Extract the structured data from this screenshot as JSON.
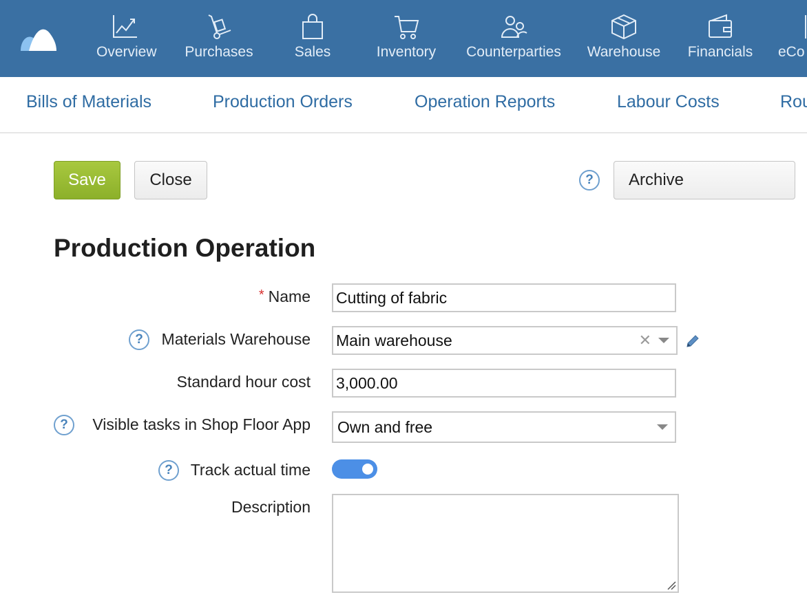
{
  "topnav": {
    "items": [
      {
        "label": "Overview",
        "icon": "chart-line-icon"
      },
      {
        "label": "Purchases",
        "icon": "hand-truck-icon"
      },
      {
        "label": "Sales",
        "icon": "shopping-bag-icon"
      },
      {
        "label": "Inventory",
        "icon": "shopping-cart-icon"
      },
      {
        "label": "Counterparties",
        "icon": "people-icon"
      },
      {
        "label": "Warehouse",
        "icon": "box-icon"
      },
      {
        "label": "Financials",
        "icon": "wallet-icon"
      },
      {
        "label": "eCo",
        "icon": "ecommerce-icon"
      }
    ]
  },
  "subnav": {
    "items": [
      "Bills of Materials",
      "Production Orders",
      "Operation Reports",
      "Labour Costs",
      "Rou"
    ]
  },
  "toolbar": {
    "save_label": "Save",
    "close_label": "Close",
    "help_glyph": "?",
    "archive_label": "Archive"
  },
  "page_title": "Production Operation",
  "form": {
    "name": {
      "label": "Name",
      "required_mark": "*",
      "value": "Cutting of fabric"
    },
    "materials_warehouse": {
      "label": "Materials Warehouse",
      "value": "Main warehouse",
      "clear_glyph": "✕"
    },
    "standard_hour_cost": {
      "label": "Standard hour cost",
      "value": "3,000.00"
    },
    "visible_tasks": {
      "label": "Visible tasks in Shop Floor App",
      "value": "Own and free"
    },
    "track_actual_time": {
      "label": "Track actual time",
      "on": true
    },
    "description": {
      "label": "Description",
      "value": ""
    }
  },
  "colors": {
    "topbar": "#3a70a3",
    "save_button": "#9bbd35",
    "link": "#2f6ca3",
    "toggle_on": "#4c8fe6",
    "required": "#d8302f"
  }
}
